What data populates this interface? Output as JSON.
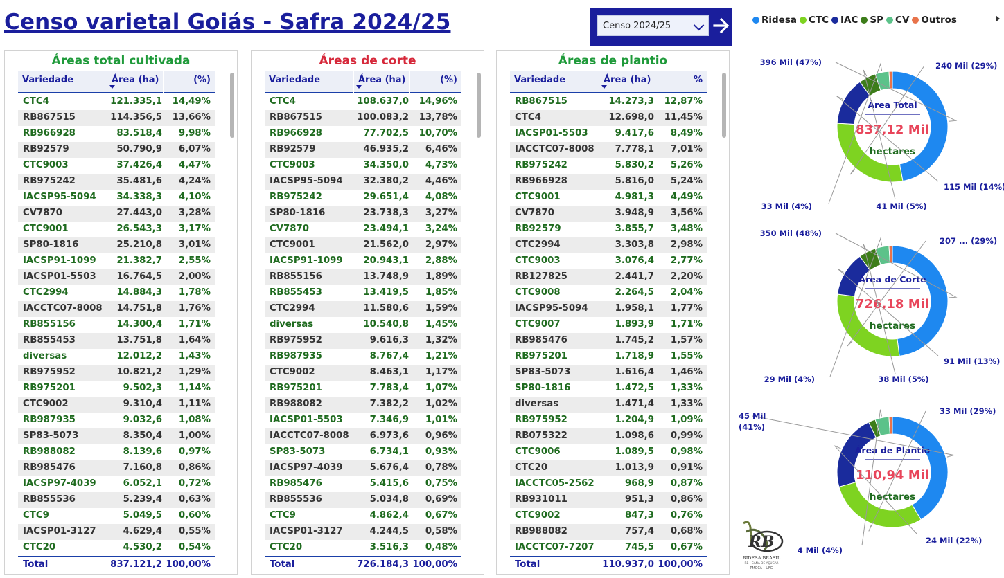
{
  "title": "Censo varietal Goiás - Safra 2024/25",
  "slicer": {
    "value": "Censo 2024/25"
  },
  "legend": [
    {
      "label": "Ridesa",
      "color": "#1e88f0"
    },
    {
      "label": "CTC",
      "color": "#7ed321"
    },
    {
      "label": "IAC",
      "color": "#1a2b9c"
    },
    {
      "label": "SP",
      "color": "#3d7d1a"
    },
    {
      "label": "CV",
      "color": "#5cc28a"
    },
    {
      "label": "Outros",
      "color": "#e8734a"
    }
  ],
  "tables": [
    {
      "title": "Áreas total cultivada",
      "title_color": "#1f9a3a",
      "headers": {
        "variedade": "Variedade",
        "area": "Área (ha)",
        "pct": "(%)"
      },
      "rows": [
        [
          "CTC4",
          "121.335,1",
          "14,49%",
          "g"
        ],
        [
          "RB867515",
          "114.356,5",
          "13,66%",
          "d"
        ],
        [
          "RB966928",
          "83.518,4",
          "9,98%",
          "g"
        ],
        [
          "RB92579",
          "50.790,9",
          "6,07%",
          "d"
        ],
        [
          "CTC9003",
          "37.426,4",
          "4,47%",
          "g"
        ],
        [
          "RB975242",
          "35.481,6",
          "4,24%",
          "d"
        ],
        [
          "IACSP95-5094",
          "34.338,3",
          "4,10%",
          "g"
        ],
        [
          "CV7870",
          "27.443,0",
          "3,28%",
          "d"
        ],
        [
          "CTC9001",
          "26.543,3",
          "3,17%",
          "g"
        ],
        [
          "SP80-1816",
          "25.210,8",
          "3,01%",
          "d"
        ],
        [
          "IACSP91-1099",
          "21.382,7",
          "2,55%",
          "g"
        ],
        [
          "IACSP01-5503",
          "16.764,5",
          "2,00%",
          "d"
        ],
        [
          "CTC2994",
          "14.884,3",
          "1,78%",
          "g"
        ],
        [
          "IACCTC07-8008",
          "14.751,8",
          "1,76%",
          "d"
        ],
        [
          "RB855156",
          "14.300,4",
          "1,71%",
          "g"
        ],
        [
          "RB855453",
          "13.751,8",
          "1,64%",
          "d"
        ],
        [
          "diversas",
          "12.012,2",
          "1,43%",
          "g"
        ],
        [
          "RB975952",
          "10.821,2",
          "1,29%",
          "d"
        ],
        [
          "RB975201",
          "9.502,3",
          "1,14%",
          "g"
        ],
        [
          "CTC9002",
          "9.310,4",
          "1,11%",
          "d"
        ],
        [
          "RB987935",
          "9.032,6",
          "1,08%",
          "g"
        ],
        [
          "SP83-5073",
          "8.350,4",
          "1,00%",
          "d"
        ],
        [
          "RB988082",
          "8.139,6",
          "0,97%",
          "g"
        ],
        [
          "RB985476",
          "7.160,8",
          "0,86%",
          "d"
        ],
        [
          "IACSP97-4039",
          "6.052,1",
          "0,72%",
          "g"
        ],
        [
          "RB855536",
          "5.239,4",
          "0,63%",
          "d"
        ],
        [
          "CTC9",
          "5.049,5",
          "0,60%",
          "g"
        ],
        [
          "IACSP01-3127",
          "4.629,4",
          "0,55%",
          "d"
        ],
        [
          "CTC20",
          "4.530,2",
          "0,54%",
          "g"
        ]
      ],
      "total": {
        "label": "Total",
        "area": "837.121,2",
        "pct": "100,00%"
      }
    },
    {
      "title": "Áreas de corte",
      "title_color": "#d6283a",
      "headers": {
        "variedade": "Variedade",
        "area": "Área (ha)",
        "pct": "(%)"
      },
      "rows": [
        [
          "CTC4",
          "108.637,0",
          "14,96%",
          "g"
        ],
        [
          "RB867515",
          "100.083,2",
          "13,78%",
          "d"
        ],
        [
          "RB966928",
          "77.702,5",
          "10,70%",
          "g"
        ],
        [
          "RB92579",
          "46.935,2",
          "6,46%",
          "d"
        ],
        [
          "CTC9003",
          "34.350,0",
          "4,73%",
          "g"
        ],
        [
          "IACSP95-5094",
          "32.380,2",
          "4,46%",
          "d"
        ],
        [
          "RB975242",
          "29.651,4",
          "4,08%",
          "g"
        ],
        [
          "SP80-1816",
          "23.738,3",
          "3,27%",
          "d"
        ],
        [
          "CV7870",
          "23.494,1",
          "3,24%",
          "g"
        ],
        [
          "CTC9001",
          "21.562,0",
          "2,97%",
          "d"
        ],
        [
          "IACSP91-1099",
          "20.943,1",
          "2,88%",
          "g"
        ],
        [
          "RB855156",
          "13.748,9",
          "1,89%",
          "d"
        ],
        [
          "RB855453",
          "13.419,5",
          "1,85%",
          "g"
        ],
        [
          "CTC2994",
          "11.580,6",
          "1,59%",
          "d"
        ],
        [
          "diversas",
          "10.540,8",
          "1,45%",
          "g"
        ],
        [
          "RB975952",
          "9.616,3",
          "1,32%",
          "d"
        ],
        [
          "RB987935",
          "8.767,4",
          "1,21%",
          "g"
        ],
        [
          "CTC9002",
          "8.463,1",
          "1,17%",
          "d"
        ],
        [
          "RB975201",
          "7.783,4",
          "1,07%",
          "g"
        ],
        [
          "RB988082",
          "7.382,2",
          "1,02%",
          "d"
        ],
        [
          "IACSP01-5503",
          "7.346,9",
          "1,01%",
          "g"
        ],
        [
          "IACCTC07-8008",
          "6.973,6",
          "0,96%",
          "d"
        ],
        [
          "SP83-5073",
          "6.734,1",
          "0,93%",
          "g"
        ],
        [
          "IACSP97-4039",
          "5.676,4",
          "0,78%",
          "d"
        ],
        [
          "RB985476",
          "5.415,6",
          "0,75%",
          "g"
        ],
        [
          "RB855536",
          "5.034,8",
          "0,69%",
          "d"
        ],
        [
          "CTC9",
          "4.862,4",
          "0,67%",
          "g"
        ],
        [
          "IACSP01-3127",
          "4.244,5",
          "0,58%",
          "d"
        ],
        [
          "CTC20",
          "3.516,3",
          "0,48%",
          "g"
        ]
      ],
      "total": {
        "label": "Total",
        "area": "726.184,3",
        "pct": "100,00%"
      }
    },
    {
      "title": "Áreas de plantio",
      "title_color": "#1f9a3a",
      "headers": {
        "variedade": "Variedade",
        "area": "Área (ha)",
        "pct": "%"
      },
      "rows": [
        [
          "RB867515",
          "14.273,3",
          "12,87%",
          "g"
        ],
        [
          "CTC4",
          "12.698,0",
          "11,45%",
          "d"
        ],
        [
          "IACSP01-5503",
          "9.417,6",
          "8,49%",
          "g"
        ],
        [
          "IACCTC07-8008",
          "7.778,1",
          "7,01%",
          "d"
        ],
        [
          "RB975242",
          "5.830,2",
          "5,26%",
          "g"
        ],
        [
          "RB966928",
          "5.816,0",
          "5,24%",
          "d"
        ],
        [
          "CTC9001",
          "4.981,3",
          "4,49%",
          "g"
        ],
        [
          "CV7870",
          "3.948,9",
          "3,56%",
          "d"
        ],
        [
          "RB92579",
          "3.855,7",
          "3,48%",
          "g"
        ],
        [
          "CTC2994",
          "3.303,8",
          "2,98%",
          "d"
        ],
        [
          "CTC9003",
          "3.076,4",
          "2,77%",
          "g"
        ],
        [
          "RB127825",
          "2.441,7",
          "2,20%",
          "d"
        ],
        [
          "CTC9008",
          "2.264,5",
          "2,04%",
          "g"
        ],
        [
          "IACSP95-5094",
          "1.958,1",
          "1,77%",
          "d"
        ],
        [
          "CTC9007",
          "1.893,9",
          "1,71%",
          "g"
        ],
        [
          "RB985476",
          "1.745,2",
          "1,57%",
          "d"
        ],
        [
          "RB975201",
          "1.718,9",
          "1,55%",
          "g"
        ],
        [
          "SP83-5073",
          "1.616,4",
          "1,46%",
          "d"
        ],
        [
          "SP80-1816",
          "1.472,5",
          "1,33%",
          "g"
        ],
        [
          "diversas",
          "1.471,4",
          "1,33%",
          "d"
        ],
        [
          "RB975952",
          "1.204,9",
          "1,09%",
          "g"
        ],
        [
          "RB075322",
          "1.098,6",
          "0,99%",
          "d"
        ],
        [
          "CTC9006",
          "1.089,5",
          "0,98%",
          "g"
        ],
        [
          "CTC20",
          "1.013,9",
          "0,91%",
          "d"
        ],
        [
          "IACCTC05-2562",
          "968,9",
          "0,87%",
          "g"
        ],
        [
          "RB931011",
          "951,3",
          "0,86%",
          "d"
        ],
        [
          "CTC9002",
          "847,3",
          "0,76%",
          "g"
        ],
        [
          "RB988082",
          "757,4",
          "0,68%",
          "d"
        ],
        [
          "IACCTC07-7207",
          "745,5",
          "0,67%",
          "g"
        ]
      ],
      "total": {
        "label": "Total",
        "area": "110.937,0",
        "pct": "100,00%"
      }
    }
  ],
  "chart_data": [
    {
      "type": "pie",
      "center_title": "Área Total",
      "center_value": "837,12 Mil",
      "center_unit": "hectares",
      "categories": [
        "Ridesa",
        "CTC",
        "IAC",
        "SP",
        "CV",
        "Outros"
      ],
      "values": [
        47,
        29,
        14,
        5,
        4,
        1
      ],
      "labels": [
        "396 Mil (47%)",
        "240 Mil (29%)",
        "115 Mil (14%)",
        "41 Mil (5%)",
        "33 Mil (4%)",
        ""
      ]
    },
    {
      "type": "pie",
      "center_title": "Área de Corte",
      "center_value": "726,18 Mil",
      "center_unit": "hectares",
      "categories": [
        "Ridesa",
        "CTC",
        "IAC",
        "SP",
        "CV",
        "Outros"
      ],
      "values": [
        48,
        29,
        13,
        5,
        4,
        1
      ],
      "labels": [
        "350 Mil (48%)",
        "207 ... (29%)",
        "91 Mil (13%)",
        "38 Mil (5%)",
        "29 Mil (4%)",
        ""
      ]
    },
    {
      "type": "pie",
      "center_title": "Área de Plantio",
      "center_value": "110,94 Mil",
      "center_unit": "hectares",
      "categories": [
        "Ridesa",
        "CTC",
        "IAC",
        "SP",
        "CV",
        "Outros"
      ],
      "values": [
        41,
        29,
        22,
        2,
        4,
        1
      ],
      "labels": [
        "45 Mil (41%)",
        "33 Mil (29%)",
        "24 Mil (22%)",
        "",
        "4 Mil (4%)",
        ""
      ]
    }
  ],
  "logo": {
    "text_1": "RIDESA BRASIL",
    "text_2": "RB - CANA DE AÇÚCAR",
    "text_3": "PMGCA – UFG"
  }
}
